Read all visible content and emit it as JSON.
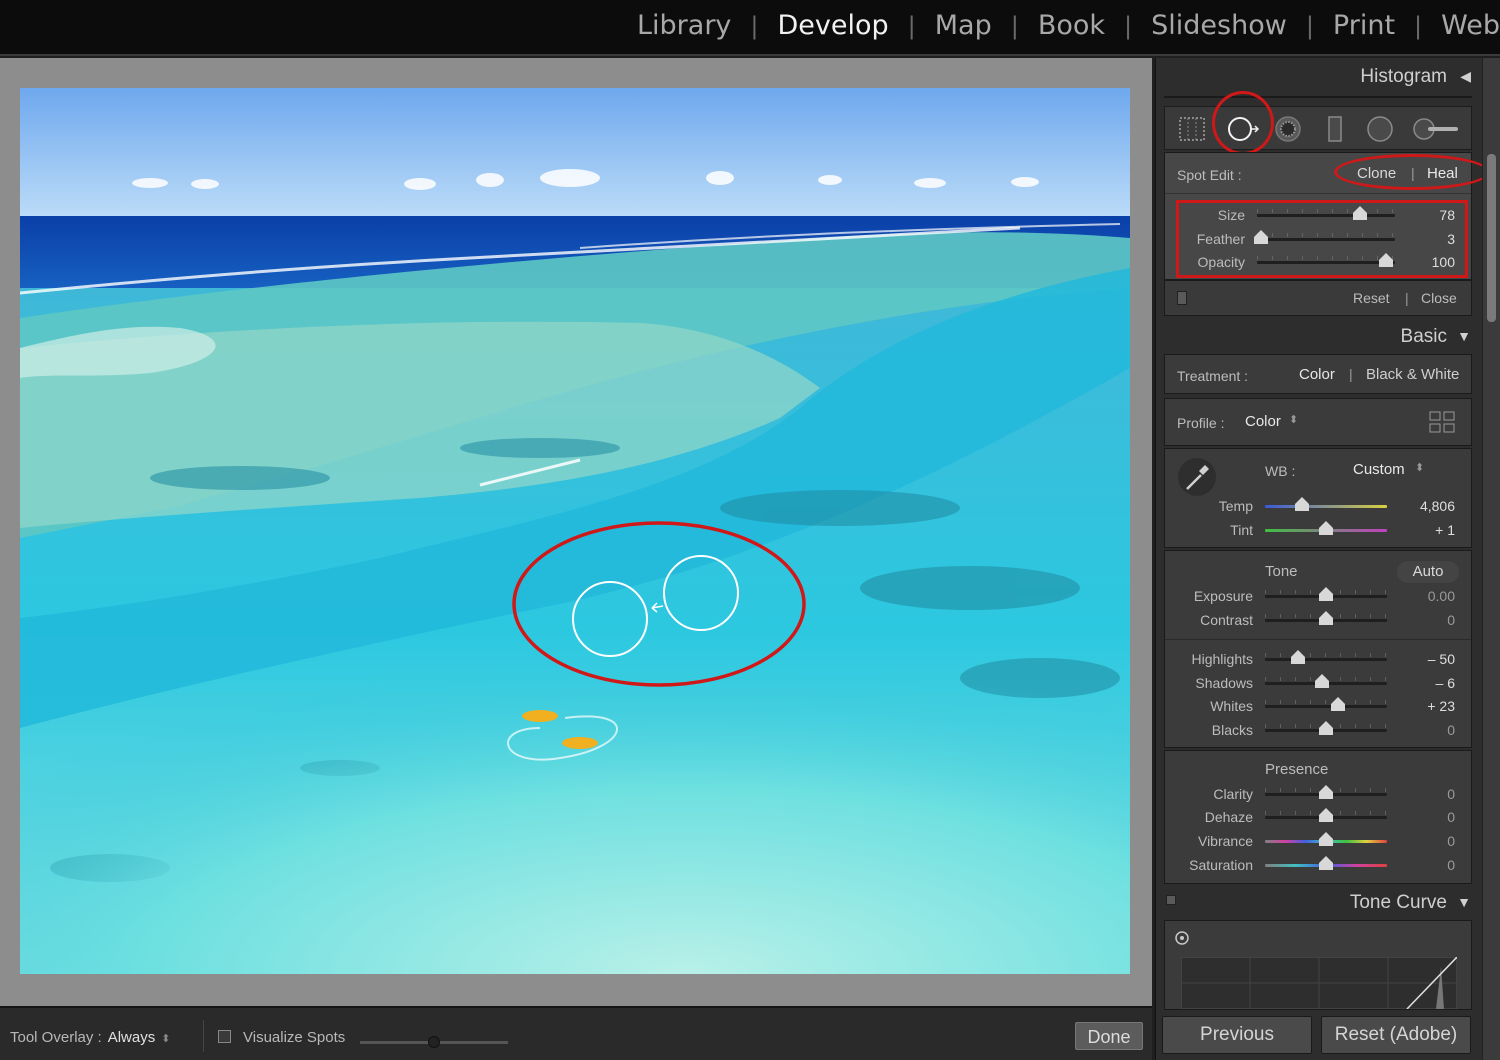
{
  "modules": [
    "Library",
    "Develop",
    "Map",
    "Book",
    "Slideshow",
    "Print",
    "Web"
  ],
  "active_module": "Develop",
  "toolbar": {
    "tool_overlay_label": "Tool Overlay :",
    "tool_overlay_value": "Always",
    "visualize_spots_label": "Visualize Spots",
    "visualize_spots_checked": false,
    "done_label": "Done"
  },
  "panel": {
    "histogram_label": "Histogram",
    "spot_edit": {
      "label": "Spot Edit :",
      "clone_label": "Clone",
      "heal_label": "Heal",
      "active_mode": "Heal",
      "sliders": [
        {
          "label": "Size",
          "value": "78"
        },
        {
          "label": "Feather",
          "value": "3"
        },
        {
          "label": "Opacity",
          "value": "100"
        }
      ],
      "reset_label": "Reset",
      "close_label": "Close"
    },
    "basic": {
      "label": "Basic",
      "treatment_label": "Treatment :",
      "treatment_color": "Color",
      "treatment_bw": "Black & White",
      "profile_label": "Profile :",
      "profile_value": "Color",
      "wb_label": "WB :",
      "wb_value": "Custom",
      "temp_label": "Temp",
      "temp_value": "4,806",
      "tint_label": "Tint",
      "tint_value": "+ 1",
      "tone_label": "Tone",
      "auto_label": "Auto",
      "tone_sliders": [
        {
          "label": "Exposure",
          "value": "0.00"
        },
        {
          "label": "Contrast",
          "value": "0"
        }
      ],
      "light_sliders": [
        {
          "label": "Highlights",
          "value": "– 50"
        },
        {
          "label": "Shadows",
          "value": "– 6"
        },
        {
          "label": "Whites",
          "value": "+ 23"
        },
        {
          "label": "Blacks",
          "value": "0"
        }
      ],
      "presence_label": "Presence",
      "presence_sliders": [
        {
          "label": "Clarity",
          "value": "0"
        },
        {
          "label": "Dehaze",
          "value": "0"
        },
        {
          "label": "Vibrance",
          "value": "0"
        },
        {
          "label": "Saturation",
          "value": "0"
        }
      ]
    },
    "tone_curve_label": "Tone Curve",
    "previous_label": "Previous",
    "reset_adobe_label": "Reset (Adobe)"
  },
  "colors": {
    "annotation_red": "#d01818",
    "panel_bg": "#2d2d2d",
    "image_frame": "#8d8d8d"
  }
}
